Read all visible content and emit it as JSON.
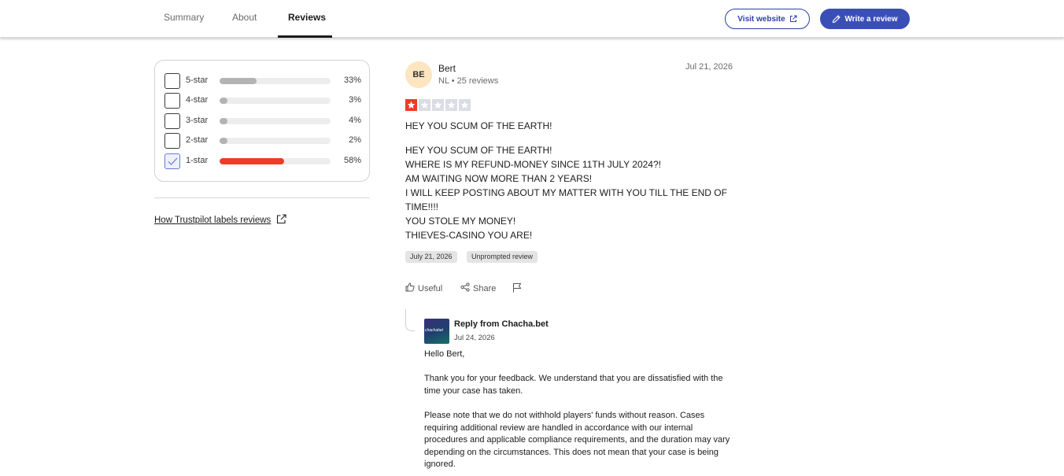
{
  "nav": {
    "tabs": [
      {
        "label": "Summary"
      },
      {
        "label": "About"
      },
      {
        "label": "Reviews",
        "active": true
      }
    ],
    "visit_label": "Visit website",
    "write_label": "Write a review"
  },
  "filters": {
    "rows": [
      {
        "label": "5-star",
        "percent_text": "33%",
        "percent": 33,
        "checked": false
      },
      {
        "label": "4-star",
        "percent_text": "3%",
        "percent": 3,
        "checked": false
      },
      {
        "label": "3-star",
        "percent_text": "4%",
        "percent": 4,
        "checked": false
      },
      {
        "label": "2-star",
        "percent_text": "2%",
        "percent": 2,
        "checked": false
      },
      {
        "label": "1-star",
        "percent_text": "58%",
        "percent": 58,
        "checked": true
      }
    ],
    "labels_link": "How Trustpilot labels reviews"
  },
  "review": {
    "initials": "BE",
    "name": "Bert",
    "country": "NL",
    "review_count": "25 reviews",
    "date": "Jul 21, 2026",
    "rating": 1,
    "max_rating": 5,
    "title": "HEY YOU SCUM OF THE EARTH!",
    "body_lines": [
      "HEY YOU SCUM OF THE EARTH!",
      "WHERE IS MY REFUND-MONEY SINCE 11TH JULY 2024?!",
      "AM WAITING NOW MORE THAN 2 YEARS!",
      "I WILL KEEP POSTING ABOUT MY MATTER WITH YOU TILL THE END OF TIME!!!!",
      "YOU STOLE MY MONEY!",
      "THIEVES-CASINO YOU ARE!"
    ],
    "experience_date": "July 21, 2026",
    "tag": "Unprompted review",
    "useful_label": "Useful",
    "share_label": "Share"
  },
  "reply": {
    "logo_text": "chachabet",
    "from": "Reply from Chacha.bet",
    "date": "Jul 24, 2026",
    "paragraphs": [
      "Hello Bert,",
      "Thank you for your feedback. We understand that you are dissatisfied with the time your case has taken.",
      "Please note that we do not withhold players' funds without reason. Cases requiring additional review are handled in accordance with our internal procedures and applicable compliance requirements, and the duration may vary depending on the circumstances. This does not mean that your case is being ignored."
    ]
  },
  "colors": {
    "accent": "#3a4fb6",
    "one_star": "#ef3b27",
    "bar_grey": "#b3b3b3",
    "avatar_bg": "#fde6bf"
  }
}
